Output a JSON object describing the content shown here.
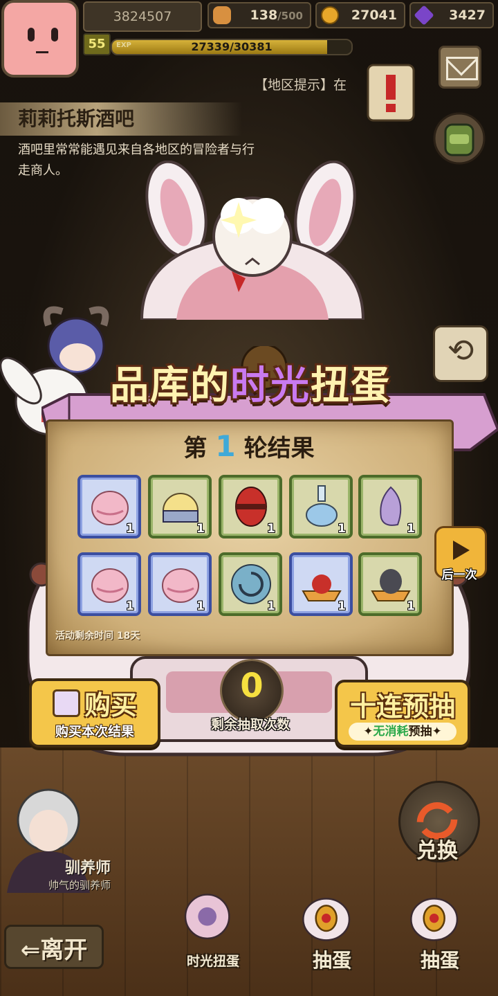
{
  "player": {
    "id": "3824507",
    "level": "55",
    "exp_text": "27339/30381",
    "exp_ratio": 0.9,
    "exp_tag": "EXP"
  },
  "resources": {
    "stamina": "138",
    "stamina_max": "/500",
    "gold": "27041",
    "gems": "3427"
  },
  "hint": "【地区提示】在",
  "location": {
    "title": "莉莉托斯酒吧",
    "desc": "酒吧里常常能遇见来自各地区的冒险者与行走商人。"
  },
  "banner": {
    "title_a": "品库的",
    "title_b": "时光",
    "title_c": "扭蛋"
  },
  "result": {
    "round_prefix": "第",
    "round_num": "1",
    "round_suffix": "轮结果",
    "time_left": "活动剩余时间  18天"
  },
  "items": [
    {
      "icon": "pink-bunny-cloth-icon",
      "rarity": "blue",
      "qty": "1"
    },
    {
      "icon": "helmet-icon",
      "rarity": "green",
      "qty": "1"
    },
    {
      "icon": "red-egg-icon",
      "rarity": "green",
      "qty": "1"
    },
    {
      "icon": "potion-flask-icon",
      "rarity": "green",
      "qty": "1"
    },
    {
      "icon": "purple-flower-icon",
      "rarity": "green",
      "qty": "1"
    },
    {
      "icon": "pink-bunny-cloth-icon",
      "rarity": "blue",
      "qty": "1"
    },
    {
      "icon": "pink-bunny-cloth-icon",
      "rarity": "blue",
      "qty": "1"
    },
    {
      "icon": "spiral-shell-icon",
      "rarity": "green",
      "qty": "1"
    },
    {
      "icon": "strawberry-tart-icon",
      "rarity": "blue",
      "qty": "1"
    },
    {
      "icon": "dark-egg-tart-icon",
      "rarity": "green",
      "qty": "1"
    }
  ],
  "buttons": {
    "next_label": "后一次",
    "buy_label": "购买",
    "buy_sub": "购买本次结果",
    "remaining_count": "0",
    "remaining_label": "剩余抽取次数",
    "ten_label": "十连预抽",
    "ten_sub_a": "无消耗",
    "ten_sub_b": "预抽",
    "exchange": "兑换",
    "leave": "⇐离开",
    "time_gacha": "时光扭蛋",
    "draw_gem": "抽蛋",
    "draw_gold": "抽蛋"
  },
  "npc": {
    "name": "驯养师",
    "subtitle": "帅气的驯养师"
  },
  "colors": {
    "accent_gold": "#f4c64a",
    "gem": "#7a45c8",
    "round_num": "#3fa9d8",
    "count": "#f6e040"
  }
}
